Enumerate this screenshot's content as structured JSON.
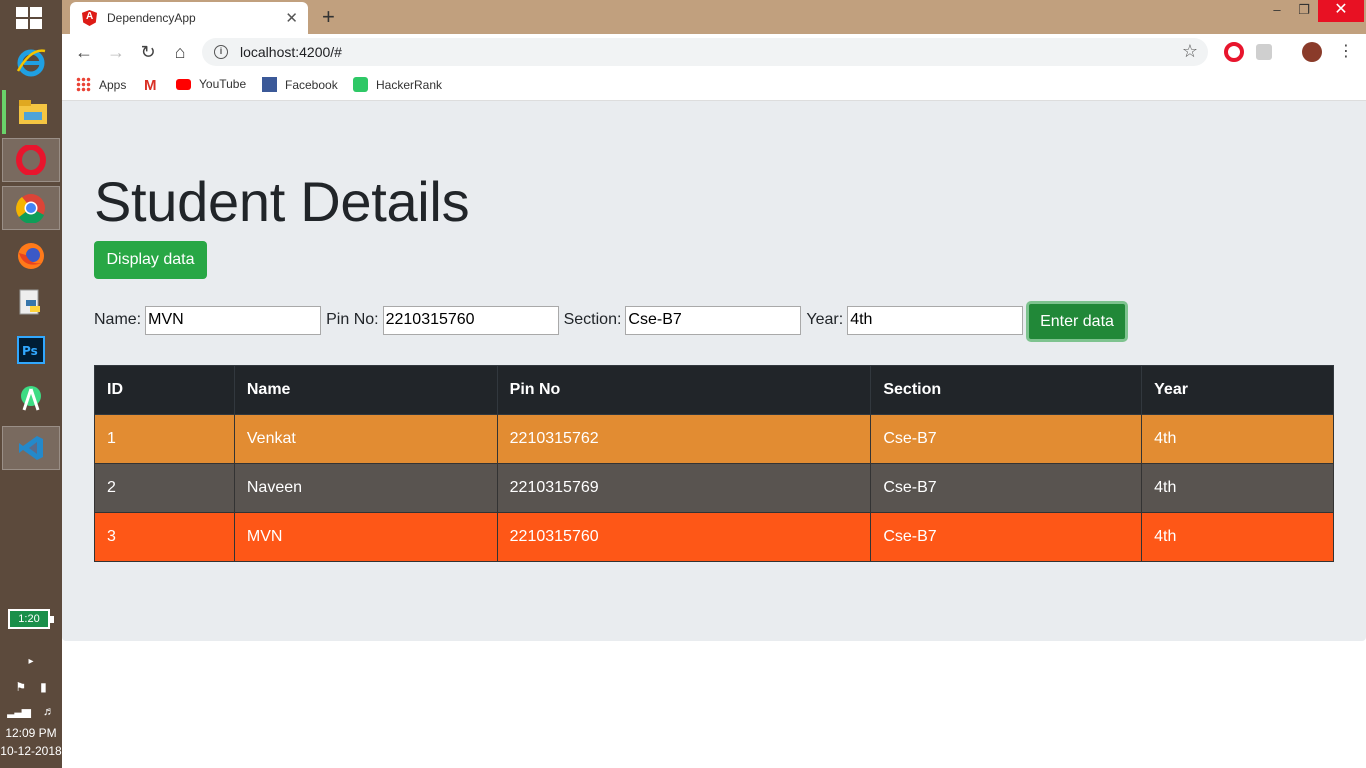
{
  "taskbar": {
    "battery_label": "1:20",
    "time": "12:09 PM",
    "date": "10-12-2018"
  },
  "browser": {
    "tab_title": "DependencyApp",
    "address": "localhost:4200/#",
    "bookmarks": [
      "Apps",
      "YouTube",
      "Facebook",
      "HackerRank"
    ]
  },
  "page": {
    "title": "Student Details",
    "display_button": "Display data",
    "enter_button": "Enter data",
    "form": {
      "name_label": "Name:",
      "name_value": "MVN",
      "pin_label": "Pin No:",
      "pin_value": "2210315760",
      "section_label": "Section:",
      "section_value": "Cse-B7",
      "year_label": "Year:",
      "year_value": "4th"
    },
    "table": {
      "headers": [
        "ID",
        "Name",
        "Pin No",
        "Section",
        "Year"
      ],
      "rows": [
        {
          "id": "1",
          "name": "Venkat",
          "pin": "2210315762",
          "section": "Cse-B7",
          "year": "4th",
          "color": "#e28c32"
        },
        {
          "id": "2",
          "name": "Naveen",
          "pin": "2210315769",
          "section": "Cse-B7",
          "year": "4th",
          "color": "#595450"
        },
        {
          "id": "3",
          "name": "MVN",
          "pin": "2210315760",
          "section": "Cse-B7",
          "year": "4th",
          "color": "#fe5717"
        }
      ]
    }
  },
  "colors": {
    "success": "#28a745",
    "jumbotron": "#e9ecef",
    "table_header": "#212529"
  }
}
